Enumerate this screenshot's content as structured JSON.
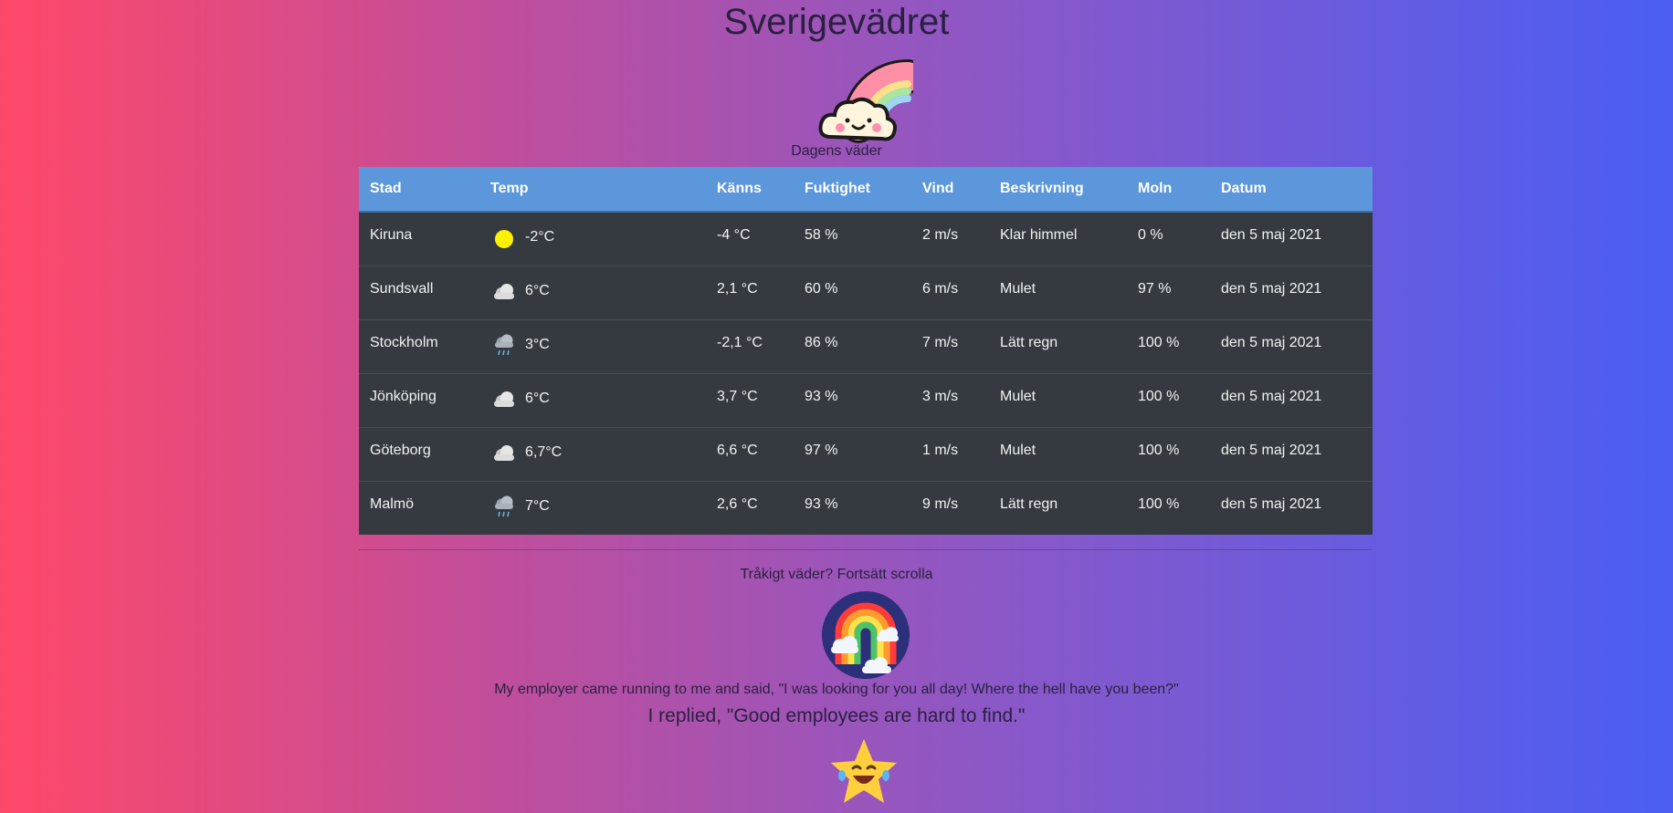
{
  "header": {
    "title": "Sverigevädret",
    "subtitle": "Dagens väder"
  },
  "table": {
    "columns": [
      "Stad",
      "Temp",
      "Känns",
      "Fuktighet",
      "Vind",
      "Beskrivning",
      "Moln",
      "Datum"
    ],
    "rows": [
      {
        "city": "Kiruna",
        "icon": "sun-icon",
        "temp": "-2°C",
        "feels": "-4 °C",
        "humidity": "58 %",
        "wind": "2 m/s",
        "desc": "Klar himmel",
        "clouds": "0 %",
        "date": "den 5 maj 2021"
      },
      {
        "city": "Sundsvall",
        "icon": "cloud-icon",
        "temp": "6°C",
        "feels": "2,1 °C",
        "humidity": "60 %",
        "wind": "6 m/s",
        "desc": "Mulet",
        "clouds": "97 %",
        "date": "den 5 maj 2021"
      },
      {
        "city": "Stockholm",
        "icon": "rain-cloud-icon",
        "temp": "3°C",
        "feels": "-2,1 °C",
        "humidity": "86 %",
        "wind": "7 m/s",
        "desc": "Lätt regn",
        "clouds": "100 %",
        "date": "den 5 maj 2021"
      },
      {
        "city": "Jönköping",
        "icon": "cloud-icon",
        "temp": "6°C",
        "feels": "3,7 °C",
        "humidity": "93 %",
        "wind": "3 m/s",
        "desc": "Mulet",
        "clouds": "100 %",
        "date": "den 5 maj 2021"
      },
      {
        "city": "Göteborg",
        "icon": "cloud-icon",
        "temp": "6,7°C",
        "feels": "6,6 °C",
        "humidity": "97 %",
        "wind": "1 m/s",
        "desc": "Mulet",
        "clouds": "100 %",
        "date": "den 5 maj 2021"
      },
      {
        "city": "Malmö",
        "icon": "rain-cloud-icon",
        "temp": "7°C",
        "feels": "2,6 °C",
        "humidity": "93 %",
        "wind": "9 m/s",
        "desc": "Lätt regn",
        "clouds": "100 %",
        "date": "den 5 maj 2021"
      }
    ]
  },
  "footer": {
    "scroll_text": "Tråkigt väder? Fortsätt scrolla",
    "joke_question": "My employer came running to me and said, \"I was looking for you all day! Where the hell have you been?\"",
    "joke_answer": "I replied, \"Good employees are hard to find.\""
  },
  "colors": {
    "table_header": "#5b97da",
    "table_body": "#343a40",
    "gradient_left": "#ff4869",
    "gradient_right": "#4a5ef3"
  },
  "icons": [
    "rainbow-cloud-logo-icon",
    "sun-icon",
    "cloud-icon",
    "rain-cloud-icon",
    "rainbow-circle-icon",
    "laughing-star-icon"
  ]
}
